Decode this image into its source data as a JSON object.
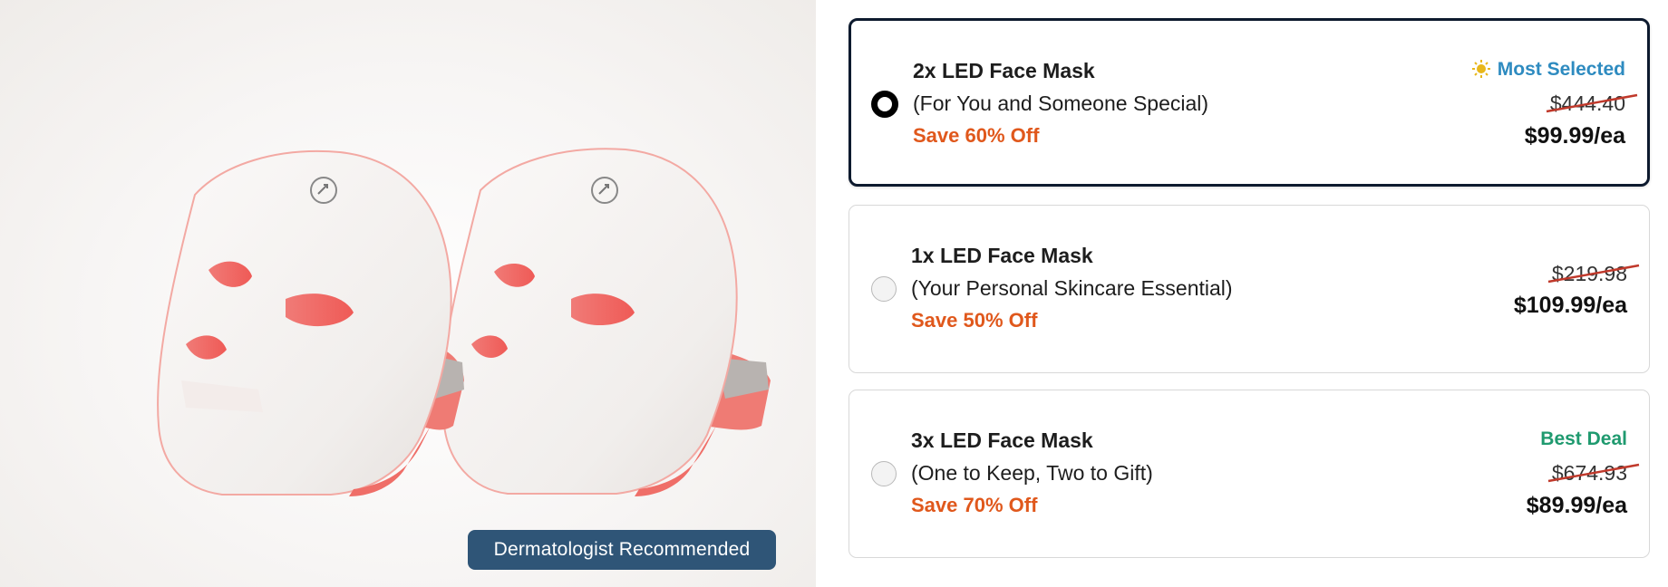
{
  "image": {
    "badge_label": "Dermatologist Recommended",
    "icons": [
      "led-face-mask-image"
    ]
  },
  "options": [
    {
      "title": "2x LED Face Mask",
      "subtitle": "(For You and Someone Special)",
      "save": "Save 60% Off",
      "tag": "Most Selected",
      "tag_icon": "sun-icon",
      "original_price": "$444.40",
      "price": "$99.99/ea",
      "selected": true
    },
    {
      "title": "1x LED Face Mask",
      "subtitle": "(Your Personal Skincare Essential)",
      "save": "Save 50% Off",
      "tag": "",
      "original_price": "$219.98",
      "price": "$109.99/ea",
      "selected": false
    },
    {
      "title": "3x LED Face Mask",
      "subtitle": "(One to Keep, Two to Gift)",
      "save": "Save 70% Off",
      "tag": "Best Deal",
      "original_price": "$674.93",
      "price": "$89.99/ea",
      "selected": false
    }
  ],
  "colors": {
    "selected_border": "#0d1a2e",
    "save_text": "#e0581c",
    "most_selected": "#2e8bc0",
    "best_deal": "#1f9a6f",
    "strike": "#c0392b",
    "badge_bg": "#2f5577"
  }
}
